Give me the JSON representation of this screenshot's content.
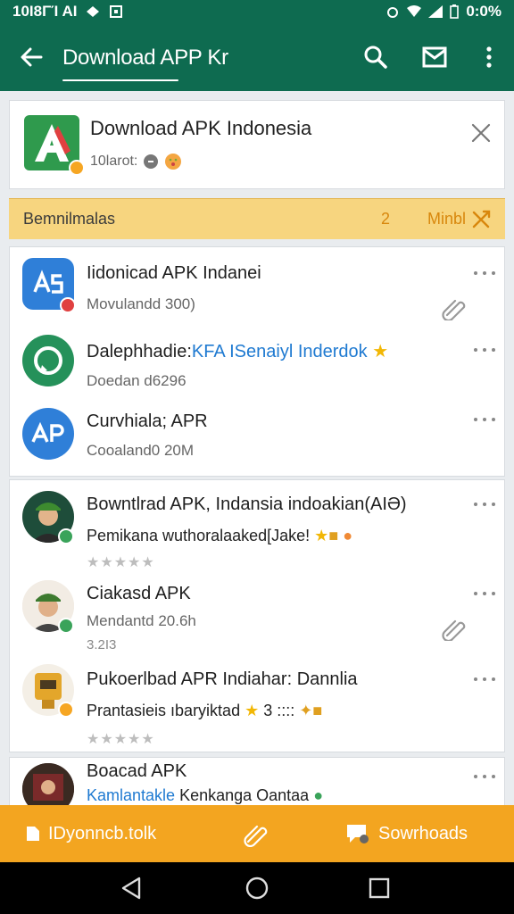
{
  "status_bar": {
    "left_text": "10I8ΓΊ ΑI",
    "right_text": "0:0%"
  },
  "app_bar": {
    "title": "Download APP Kr"
  },
  "header_card": {
    "name": "Download APK Indonesia",
    "meta_text": "10larot:"
  },
  "banner": {
    "label": "Bemnilmalas",
    "count": "2",
    "more_label": "Minbl"
  },
  "list1": [
    {
      "title": "Iidonicad APK Indanei",
      "sub": "Movulandd 300)"
    },
    {
      "title_prefix": "Dalephhadie:",
      "title_highlight": "KFA ISenaiyl Inderdok",
      "sub": "Doedan d6296"
    },
    {
      "title": "Curvhiala; APR",
      "sub": "Cooaland0 20M"
    }
  ],
  "list2": [
    {
      "title": "Bowntlrad APK, Indansia indoakian(AIƏ)",
      "sub": "Pemikana wuthoralaaked[Jake!",
      "rating": "★★★★★"
    },
    {
      "title": "Ciakasd APK",
      "sub": "Mendantd 20.6h",
      "sub2": "3.2I3"
    },
    {
      "title": "Pukoerlbad APR Indiahar: Dannlia",
      "sub": "Prantasieis ıbaryiktad",
      "sub_extra": "3 ::::",
      "rating": "★★★★★"
    }
  ],
  "list3": [
    {
      "title": "Boacad APK",
      "sub_highlight": "Kamlantakle",
      "sub": "Kenkanga Oantaa"
    }
  ],
  "bottom_bar": {
    "left_label": "IDyonncb.tolk",
    "right_label": "Sowrhoads"
  },
  "colors": {
    "primary": "#0e6b50",
    "accent": "#f3a520",
    "banner": "#f7d57f",
    "link": "#1f7ad1"
  }
}
